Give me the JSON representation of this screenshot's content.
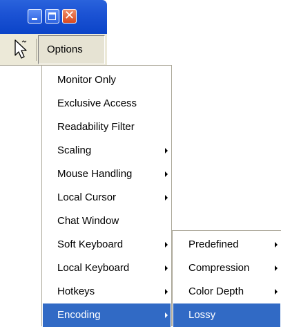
{
  "window": {
    "buttons": [
      {
        "name": "minimize",
        "icon": "minimize-icon"
      },
      {
        "name": "maximize",
        "icon": "maximize-icon"
      },
      {
        "name": "close",
        "icon": "close-icon",
        "glyph": "✕"
      }
    ]
  },
  "toolbar": {
    "cursor_icon": "mouse-pointer-icon",
    "options_label": "Options"
  },
  "menu": {
    "items": [
      {
        "label": "Monitor Only",
        "submenu": false
      },
      {
        "label": "Exclusive Access",
        "submenu": false
      },
      {
        "label": "Readability Filter",
        "submenu": false
      },
      {
        "label": "Scaling",
        "submenu": true
      },
      {
        "label": "Mouse Handling",
        "submenu": true
      },
      {
        "label": "Local Cursor",
        "submenu": true
      },
      {
        "label": "Chat Window",
        "submenu": false
      },
      {
        "label": "Soft Keyboard",
        "submenu": true
      },
      {
        "label": "Local Keyboard",
        "submenu": true
      },
      {
        "label": "Hotkeys",
        "submenu": true
      },
      {
        "label": "Encoding",
        "submenu": true,
        "highlighted": true
      }
    ]
  },
  "submenu": {
    "items": [
      {
        "label": "Predefined",
        "submenu": true
      },
      {
        "label": "Compression",
        "submenu": true
      },
      {
        "label": "Color Depth",
        "submenu": true
      },
      {
        "label": "Lossy",
        "submenu": false,
        "highlighted": true
      }
    ]
  },
  "colors": {
    "highlight": "#316ac5",
    "titlebar": "#1c53d4",
    "menubar": "#ece9d8"
  }
}
